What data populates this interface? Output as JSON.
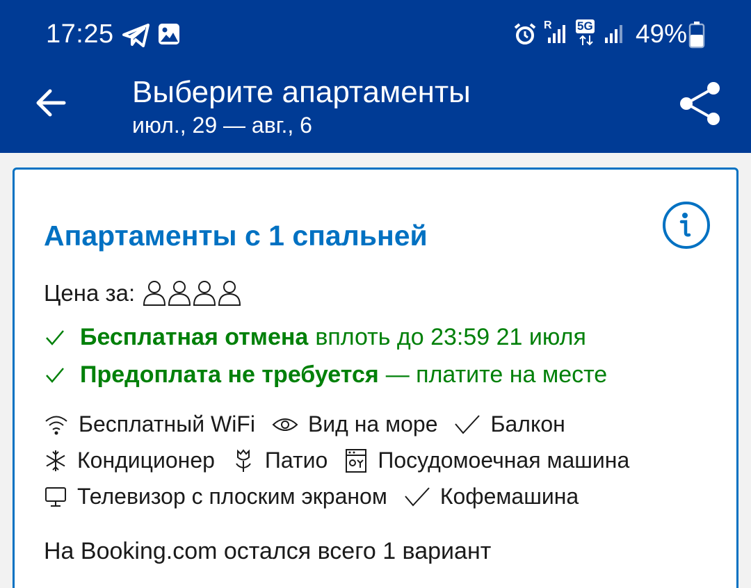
{
  "status_bar": {
    "time": "17:25",
    "battery": "49%",
    "network_label": "5G",
    "roaming_label": "R"
  },
  "header": {
    "title": "Выберите апартаменты",
    "dates": "июл., 29 — авг., 6"
  },
  "room": {
    "title": "Апартаменты с 1 спальней",
    "price_for_label": "Цена за:",
    "persons_count": 4,
    "conditions": [
      {
        "bold": "Бесплатная отмена",
        "rest": "вплоть до 23:59 21 июля"
      },
      {
        "bold": "Предоплата не требуется",
        "rest": "— платите на месте"
      }
    ],
    "amenities": [
      {
        "icon": "wifi-icon",
        "label": "Бесплатный WiFi"
      },
      {
        "icon": "eye-icon",
        "label": "Вид на море"
      },
      {
        "icon": "check-icon",
        "label": "Балкон"
      },
      {
        "icon": "snowflake-icon",
        "label": "Кондиционер"
      },
      {
        "icon": "flower-icon",
        "label": "Патио"
      },
      {
        "icon": "dishwasher-icon",
        "label": "Посудомоечная машина"
      },
      {
        "icon": "tv-icon",
        "label": "Телевизор с плоским экраном"
      },
      {
        "icon": "check-icon",
        "label": "Кофемашина"
      }
    ],
    "availability": "На Booking.com остался всего 1 вариант"
  },
  "colors": {
    "header_bg": "#003b95",
    "accent_blue": "#0071c2",
    "green": "#008009"
  }
}
